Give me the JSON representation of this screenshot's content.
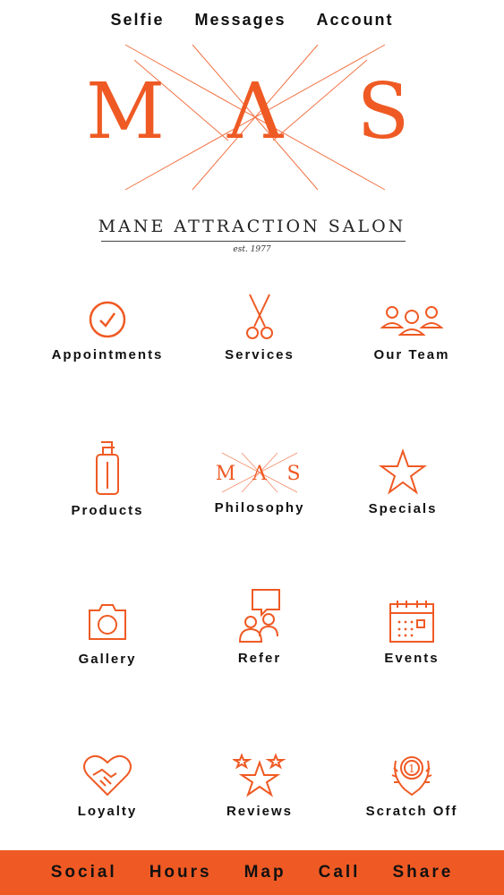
{
  "top_nav": {
    "items": [
      "Selfie",
      "Messages",
      "Account"
    ]
  },
  "logo": {
    "monogram": [
      "M",
      "A",
      "S"
    ],
    "brand": "MANE ATTRACTION SALON",
    "est": "est. 1977"
  },
  "grid": {
    "items": [
      {
        "label": "Appointments",
        "icon": "checkmark-circle-icon"
      },
      {
        "label": "Services",
        "icon": "scissors-icon"
      },
      {
        "label": "Our Team",
        "icon": "team-icon"
      },
      {
        "label": "Products",
        "icon": "pump-bottle-icon"
      },
      {
        "label": "Philosophy",
        "icon": "mas-monogram-icon"
      },
      {
        "label": "Specials",
        "icon": "star-icon"
      },
      {
        "label": "Gallery",
        "icon": "camera-icon"
      },
      {
        "label": "Refer",
        "icon": "refer-chat-icon"
      },
      {
        "label": "Events",
        "icon": "calendar-icon"
      },
      {
        "label": "Loyalty",
        "icon": "heart-handshake-icon"
      },
      {
        "label": "Reviews",
        "icon": "stars-icon"
      },
      {
        "label": "Scratch Off",
        "icon": "medal-icon"
      }
    ]
  },
  "bottom_bar": {
    "items": [
      "Social",
      "Hours",
      "Map",
      "Call",
      "Share"
    ]
  },
  "colors": {
    "accent": "#ef5a24",
    "text": "#111111",
    "background": "#ffffff"
  }
}
